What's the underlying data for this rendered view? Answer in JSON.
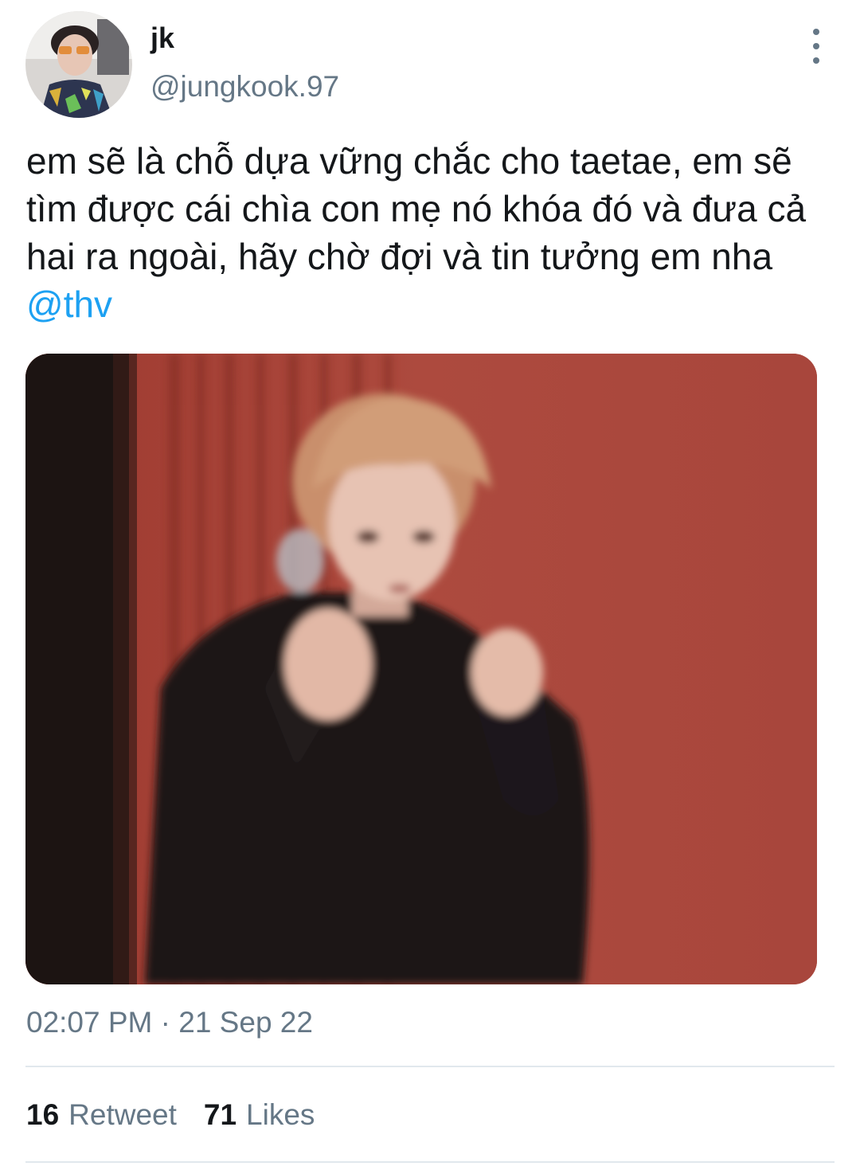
{
  "author": {
    "display_name": "jk",
    "handle": "@jungkook.97"
  },
  "tweet": {
    "text_before_mention": "em sẽ là chỗ dựa vững chắc cho taetae, em sẽ tìm được cái chìa con mẹ nó khóa đó và đưa cả hai ra ngoài, hãy chờ đợi và tin tưởng em nha ",
    "mention": "@thv",
    "timestamp": "02:07 PM · 21 Sep 22"
  },
  "stats": {
    "retweet_count": "16",
    "retweet_label": "Retweet",
    "likes_count": "71",
    "likes_label": "Likes"
  },
  "icons": {
    "more": "more-vertical-icon"
  },
  "colors": {
    "text": "#14171a",
    "secondary": "#657786",
    "link": "#1da1f2",
    "divider": "#e1e8ed"
  }
}
